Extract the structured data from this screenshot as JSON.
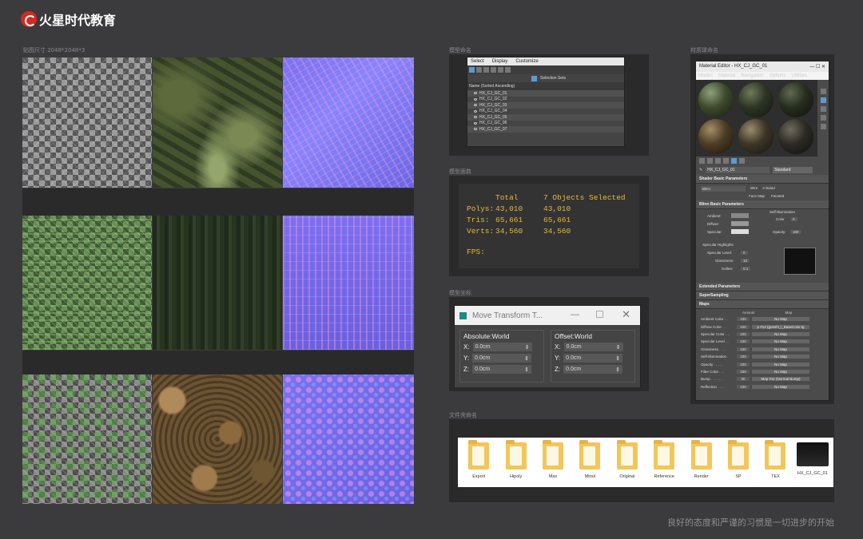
{
  "brand": {
    "name": "火星时代教育",
    "logo_color": "#d32a23"
  },
  "captions": {
    "textures": "贴图尺寸 2048*2048*3",
    "scene_explorer": "模型命名",
    "statistics": "模型面数",
    "transform": "模型坐标",
    "material_editor": "材质球命名",
    "files": "文件夹命名"
  },
  "scene_explorer": {
    "menu": [
      "Select",
      "Display",
      "Customize"
    ],
    "header": "Name (Sorted Ascending)",
    "selection_sets": "Selection Sets",
    "objects": [
      "HX_CJ_GC_01",
      "HX_CJ_GC_02",
      "HX_CJ_GC_03",
      "HX_CJ_GC_04",
      "HX_CJ_GC_05",
      "HX_CJ_GC_06",
      "HX_CJ_GC_07"
    ]
  },
  "statistics": {
    "col_total": "Total",
    "col_selected": "7 Objects Selected",
    "polys_label": "Polys:",
    "polys_total": "43,010",
    "polys_sel": "43,010",
    "tris_label": "Tris:",
    "tris_total": "65,661",
    "tris_sel": "65,661",
    "verts_label": "Verts:",
    "verts_total": "34,560",
    "verts_sel": "34,560",
    "fps_label": "FPS:"
  },
  "transform": {
    "title": "Move Transform T...",
    "absolute": "Absolute:World",
    "offset": "Offset:World",
    "abs_x": "0.0cm",
    "abs_y": "0.0cm",
    "abs_z": "0.0cm",
    "off_x": "0.0cm",
    "off_y": "0.0cm",
    "off_z": "0.0cm",
    "x": "X:",
    "y": "Y:",
    "z": "Z:"
  },
  "material_editor": {
    "title": "Material Editor - HX_CJ_GC_01",
    "menu": [
      "Modes",
      "Material",
      "Navigation",
      "Options",
      "Utilities"
    ],
    "material_name": "HX_CJ_GC_01",
    "material_type": "Standard",
    "shader_rollout": "Shader Basic Parameters",
    "shader": "Blinn",
    "wire": "Wire",
    "two_sided": "2-Sided",
    "face_map": "Face Map",
    "faceted": "Faceted",
    "blinn_rollout": "Blinn Basic Parameters",
    "self_illum": "Self-Illumination",
    "ambient": "Ambient:",
    "diffuse": "Diffuse:",
    "specular": "Specular:",
    "color": "Color",
    "color_val": "0",
    "opacity": "Opacity:",
    "opacity_val": "100",
    "spec_highlights": "Specular Highlights",
    "spec_level": "Specular Level:",
    "spec_level_val": "0",
    "glossiness": "Glossiness:",
    "glossiness_val": "10",
    "soften": "Soften:",
    "soften_val": "0.1",
    "extended": "Extended Parameters",
    "supersampling": "SuperSampling",
    "maps": "Maps",
    "amount_header": "Amount",
    "map_header": "Map",
    "map_rows": [
      {
        "label": "Ambient Color . .",
        "amount": "100",
        "map": "No Map"
      },
      {
        "label": "Diffuse Color . .",
        "amount": "100",
        "map": "p #13 (gonshl_l_BaseColor.tg"
      },
      {
        "label": "Specular Color . .",
        "amount": "100",
        "map": "No Map"
      },
      {
        "label": "Specular Level . .",
        "amount": "100",
        "map": "No Map"
      },
      {
        "label": "Glossiness . . . .",
        "amount": "100",
        "map": "No Map"
      },
      {
        "label": "Self-Illumination .",
        "amount": "100",
        "map": "No Map"
      },
      {
        "label": "Opacity . . . . .",
        "amount": "100",
        "map": "No Map"
      },
      {
        "label": "Filter Color . . .",
        "amount": "100",
        "map": "No Map"
      },
      {
        "label": "Bump . . . . . .",
        "amount": "30",
        "map": "Map #11 (Normal Bump)"
      },
      {
        "label": "Reflection . . . .",
        "amount": "100",
        "map": "No Map"
      }
    ]
  },
  "folders": [
    "Export",
    "Hipoly",
    "Max",
    "Mtool",
    "Original",
    "Reference",
    "Render",
    "SP",
    "TEX",
    "HX_CJ_GC_01"
  ],
  "slogan": "良好的态度和严谨的习惯是一切进步的开始"
}
